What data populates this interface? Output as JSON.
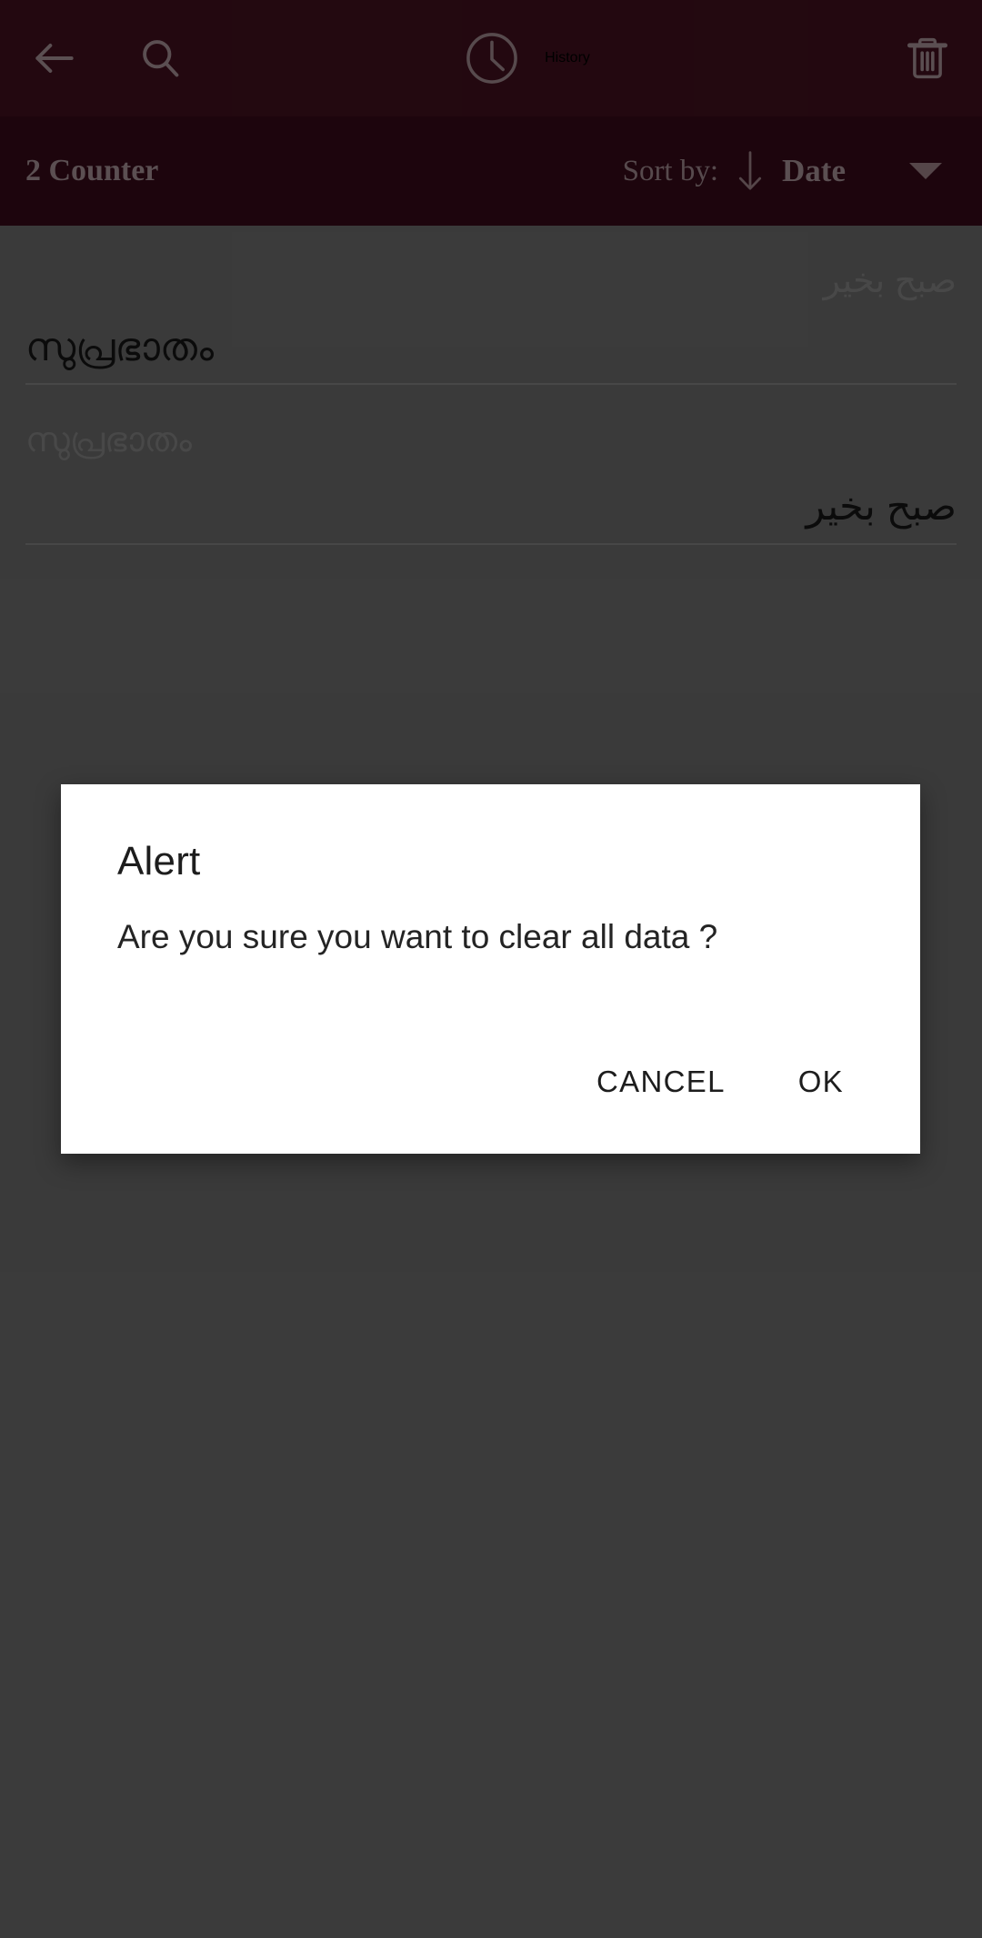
{
  "colors": {
    "app_bar": "#3d0f1c",
    "sort_bar": "#320a18",
    "app_bar_foreground": "#9d888d",
    "scrim": "#656565",
    "dialog_background": "#ffffff",
    "dialog_text": "#1d1d1d",
    "list_divider": "#7a7a7a",
    "source_text": "#7d7d7d",
    "target_text": "#141414"
  },
  "app_bar": {
    "back_icon": "arrow-left-icon",
    "search_icon": "search-icon",
    "clock_icon": "clock-icon",
    "title": "History",
    "delete_icon": "trash-icon"
  },
  "sort_bar": {
    "counter_label": "2 Counter",
    "sort_by_label": "Sort by:",
    "sort_direction_icon": "arrow-down-icon",
    "sort_field": "Date",
    "dropdown_icon": "chevron-down-icon"
  },
  "history": {
    "rows": [
      {
        "source_text": "صبح بخير",
        "source_dir": "rtl",
        "target_text": "സുപ്രഭാതം",
        "target_dir": "ltr"
      },
      {
        "source_text": "സുപ്രഭാതം",
        "source_dir": "ltr",
        "target_text": "صبح بخير",
        "target_dir": "rtl"
      }
    ]
  },
  "alert_dialog": {
    "title": "Alert",
    "message": "Are you sure you want to clear all data ?",
    "cancel_label": "CANCEL",
    "ok_label": "OK"
  }
}
